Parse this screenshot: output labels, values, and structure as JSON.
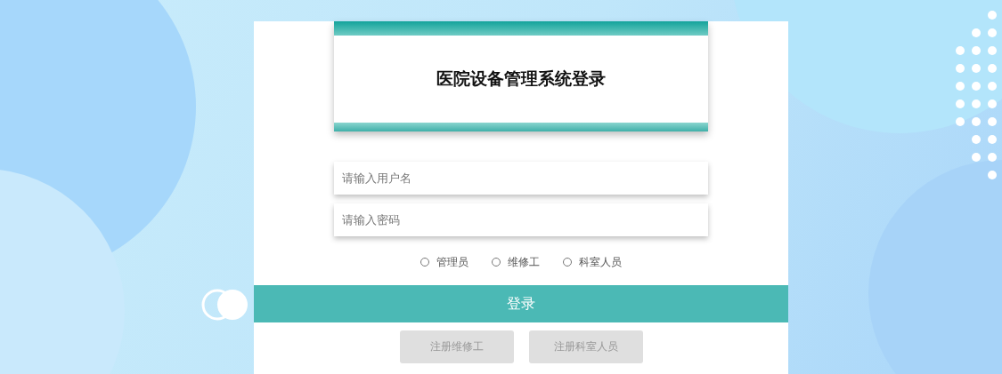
{
  "title": "医院设备管理系统登录",
  "fields": [
    {
      "placeholder": "请输入用户名"
    },
    {
      "placeholder": "请输入密码"
    }
  ],
  "roles": [
    {
      "label": "管理员",
      "selected": false
    },
    {
      "label": "维修工",
      "selected": false
    },
    {
      "label": "科室人员",
      "selected": false
    }
  ],
  "login_button": "登录",
  "register_buttons": [
    "注册维修工",
    "注册科室人员"
  ]
}
